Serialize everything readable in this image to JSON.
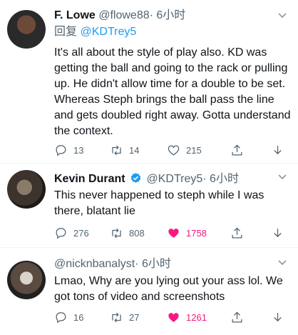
{
  "tweets": [
    {
      "name": "F. Lowe",
      "handle": "@flowe88",
      "time": "· 6小时",
      "reply_prefix": "回复",
      "reply_to": "@KDTrey5",
      "text": "It's all about the style of play also. KD was getting the ball and going to the rack or pulling up. He didn't allow time for a double to be set. Whereas Steph brings the ball pass the line and gets doubled right away. Gotta understand the context.",
      "replies": "13",
      "retweets": "14",
      "likes": "215",
      "liked": false
    },
    {
      "name": "Kevin Durant",
      "verified": true,
      "handle": "@KDTrey5",
      "time": "· 6小时",
      "text": "This never happened to steph while I was there, blatant lie",
      "replies": "276",
      "retweets": "808",
      "likes": "1758",
      "liked": true
    },
    {
      "handle": "@nicknbanalyst",
      "time": "· 6小时",
      "text": "Lmao, Why are you lying out your ass lol. We got tons of video and screenshots",
      "replies": "16",
      "retweets": "27",
      "likes": "1261",
      "liked": true
    }
  ],
  "colors": {
    "accent": "#1d9bf0",
    "like": "#f91880",
    "muted": "#536471"
  },
  "icons": [
    "reply-icon",
    "retweet-icon",
    "like-icon",
    "share-icon",
    "download-icon",
    "more-caret-icon",
    "verified-badge-icon"
  ]
}
